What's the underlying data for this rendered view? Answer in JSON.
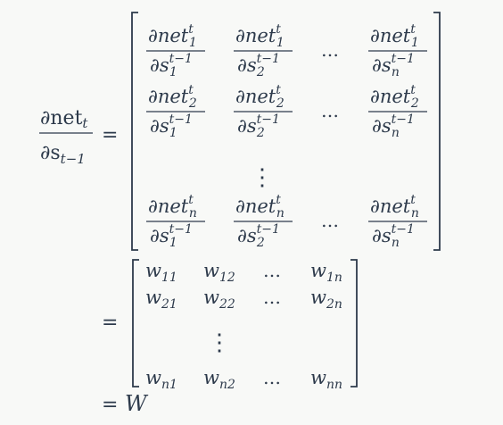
{
  "lhs": {
    "num_base": "∂net",
    "num_sub": "t",
    "den_base": "∂s",
    "den_sub": "t−1"
  },
  "relation": "=",
  "partial": "∂",
  "jacobian": {
    "numerator_word": "net",
    "numerator_sup": "t",
    "denominator_var": "s",
    "denominator_sup": "t−1",
    "rows": [
      [
        {
          "num_sub": "1",
          "den_sub": "1"
        },
        {
          "num_sub": "1",
          "den_sub": "2"
        },
        "…",
        {
          "num_sub": "1",
          "den_sub": "n"
        }
      ],
      [
        {
          "num_sub": "2",
          "den_sub": "1"
        },
        {
          "num_sub": "2",
          "den_sub": "2"
        },
        "…",
        {
          "num_sub": "2",
          "den_sub": "n"
        }
      ],
      [
        {
          "num_sub": "n",
          "den_sub": "1"
        },
        {
          "num_sub": "n",
          "den_sub": "2"
        },
        "…",
        {
          "num_sub": "n",
          "den_sub": "n"
        }
      ]
    ],
    "vdots": "⋮"
  },
  "weight_matrix": {
    "symbol": "w",
    "rows": [
      [
        "11",
        "12",
        "…",
        "1n"
      ],
      [
        "21",
        "22",
        "…",
        "2n"
      ],
      [
        "n1",
        "n2",
        "…",
        "nn"
      ]
    ],
    "vdots": "⋮"
  },
  "result": "W"
}
